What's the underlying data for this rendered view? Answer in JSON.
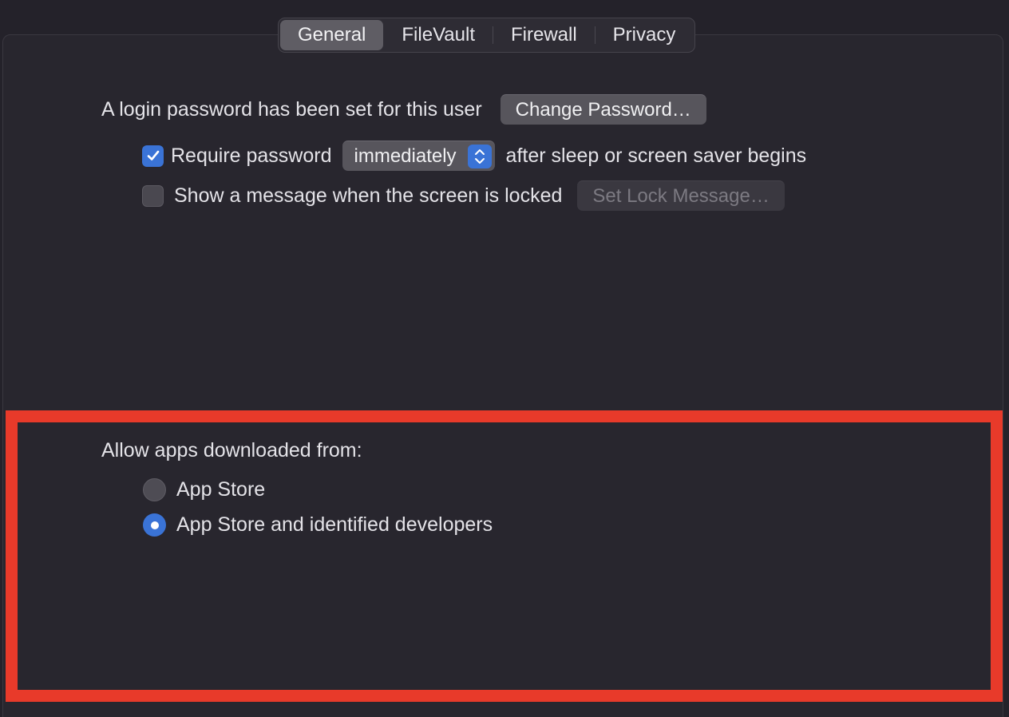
{
  "tabs": [
    {
      "label": "General",
      "selected": true
    },
    {
      "label": "FileVault",
      "selected": false
    },
    {
      "label": "Firewall",
      "selected": false
    },
    {
      "label": "Privacy",
      "selected": false
    }
  ],
  "general": {
    "login_password_text": "A login password has been set for this user",
    "change_password_label": "Change Password…",
    "require_password": {
      "label": "Require password",
      "checked": true,
      "selected_value": "immediately",
      "suffix": "after sleep or screen saver begins"
    },
    "show_message": {
      "label": "Show a message when the screen is locked",
      "checked": false,
      "button_label": "Set Lock Message…"
    }
  },
  "allow_apps": {
    "heading": "Allow apps downloaded from:",
    "options": [
      {
        "label": "App Store",
        "selected": false
      },
      {
        "label": "App Store and identified developers",
        "selected": true
      }
    ]
  },
  "colors": {
    "accent": "#3a73d6",
    "highlight": "#e83a2a",
    "background": "#24222a"
  }
}
